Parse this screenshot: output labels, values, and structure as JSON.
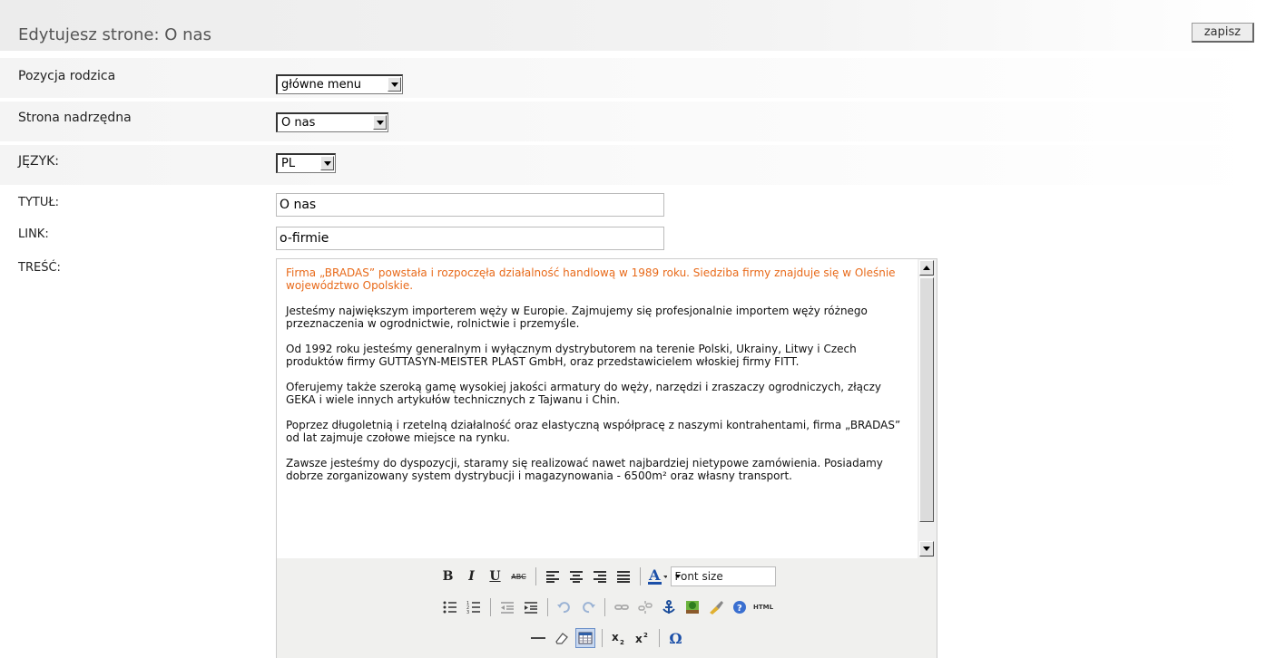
{
  "header": {
    "title": "Edytujesz strone: O nas",
    "save_label": "zapisz"
  },
  "form": {
    "parent_position": {
      "label": "Pozycja rodzica",
      "value": "główne menu"
    },
    "parent_page": {
      "label": "Strona nadrzędna",
      "value": "O nas"
    },
    "language": {
      "label": "JĘZYK:",
      "value": "PL"
    },
    "title": {
      "label": "TYTUŁ:",
      "value": "O nas"
    },
    "link": {
      "label": "LINK:",
      "value": "o-firmie"
    },
    "content": {
      "label": "TREŚĆ:"
    }
  },
  "editor": {
    "paragraphs": [
      "Firma „BRADAS” powstała i rozpoczęła działalność handlową w 1989 roku. Siedziba firmy znajduje się w Oleśnie województwo Opolskie.",
      "Jesteśmy największym importerem węży w Europie. Zajmujemy się profesjonalnie importem węży różnego przeznaczenia w ogrodnictwie, rolnictwie i przemyśle.",
      "Od 1992 roku jesteśmy generalnym i wyłącznym dystrybutorem na terenie Polski, Ukrainy, Litwy i Czech produktów firmy GUTTASYN-MEISTER PLAST GmbH, oraz przedstawicielem włoskiej firmy FITT.",
      "Oferujemy także szeroką gamę wysokiej jakości armatury do węży, narzędzi i zraszaczy ogrodniczych, złączy GEKA i wiele innych artykułów technicznych z Tajwanu i Chin.",
      "Poprzez długoletnią i rzetelną działalność oraz elastyczną współpracę z naszymi kontrahentami, firma „BRADAS” od lat zajmuje czołowe miejsce na rynku.",
      "Zawsze jesteśmy do dyspozycji, staramy się realizować nawet najbardziej nietypowe zamówienia. Posiadamy dobrze zorganizowany system dystrybucji i magazynowania - 6500m² oraz własny transport."
    ],
    "first_paragraph_color": "#e86a1a",
    "font_size_label": "Font size",
    "bold_glyph": "B",
    "italic_glyph": "I",
    "underline_glyph": "U",
    "strike_glyph": "ABC",
    "html_glyph": "HTML",
    "omega_glyph": "Ω"
  }
}
